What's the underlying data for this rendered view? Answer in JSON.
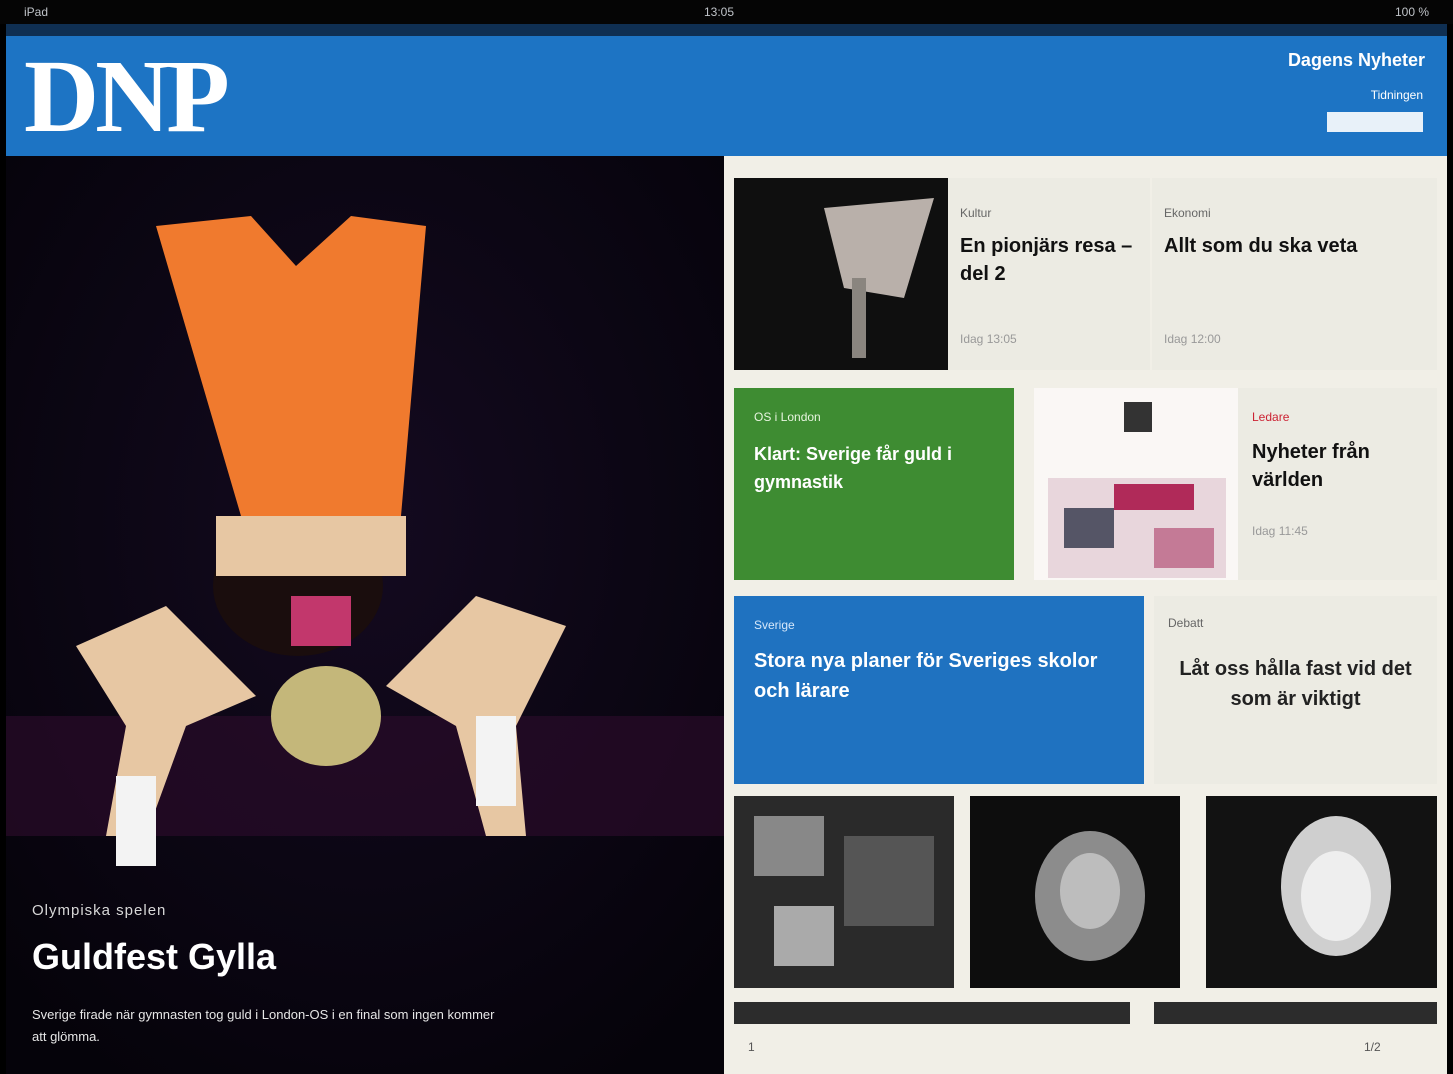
{
  "status": {
    "left": "iPad",
    "center": "13:05",
    "right": "100 %"
  },
  "header": {
    "logo": "DNP",
    "top_link": "Dagens Nyheter",
    "sub_link": "Tidningen",
    "button": ""
  },
  "hero": {
    "kicker": "Olympiska spelen",
    "title": "Guldfest Gylla",
    "subtitle": "Sverige firade när gymnasten tog guld i London-OS i en final som ingen kommer att glömma."
  },
  "tiles": [
    {
      "kicker": "Kultur",
      "title": "En pionjärs resa – del 2",
      "meta": "Idag 13:05"
    },
    {
      "kicker": "Ekonomi",
      "title": "Allt som du ska veta",
      "meta": "Idag 12:00"
    },
    {
      "kicker": "OS i London",
      "title": "Klart: Sverige får guld i gymnastik",
      "meta": ""
    },
    {
      "kicker": "Ledare",
      "title": "Nyheter från världen",
      "meta": "Idag 11:45"
    },
    {
      "kicker": "Sverige",
      "title": "Stora nya planer för Sveriges skolor och lärare",
      "meta": ""
    },
    {
      "kicker": "Debatt",
      "title": "Låt oss hålla fast vid det som är viktigt",
      "meta": ""
    }
  ],
  "footer": {
    "page": "1",
    "pages": "1/2"
  },
  "colors": {
    "brand": "#1d74c4",
    "green": "#3e8c32",
    "blue": "#1f72c0"
  }
}
